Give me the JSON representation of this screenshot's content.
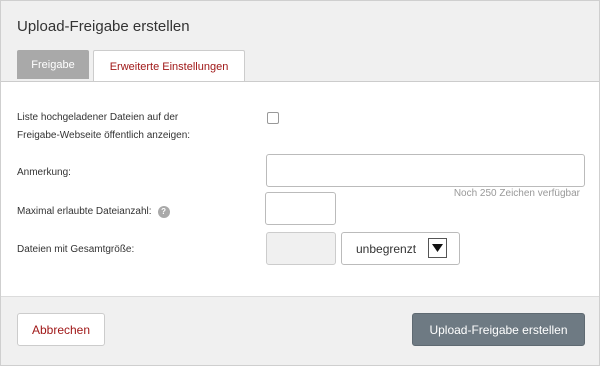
{
  "dialog": {
    "title": "Upload-Freigabe erstellen"
  },
  "tabs": [
    {
      "label": "Freigabe",
      "active": false
    },
    {
      "label": "Erweiterte Einstellungen",
      "active": true
    }
  ],
  "form": {
    "public_list": {
      "label_line1": "Liste hochgeladener Dateien auf der",
      "label_line2": "Freigabe-Webseite öffentlich anzeigen:",
      "checked": false
    },
    "note": {
      "label": "Anmerkung:",
      "value": "",
      "hint": "Noch 250 Zeichen verfügbar"
    },
    "max_files": {
      "label": "Maximal erlaubte Dateianzahl:",
      "help_icon": "question-circle-icon",
      "help_glyph": "?",
      "value": ""
    },
    "total_size": {
      "label": "Dateien mit Gesamtgröße:",
      "value": "",
      "unit_selected": "unbegrenzt"
    }
  },
  "footer": {
    "cancel_label": "Abbrechen",
    "create_label": "Upload-Freigabe erstellen"
  },
  "colors": {
    "accent_text": "#a01818",
    "primary_button": "#6e7a83",
    "inactive_tab": "#a9a9a9"
  }
}
